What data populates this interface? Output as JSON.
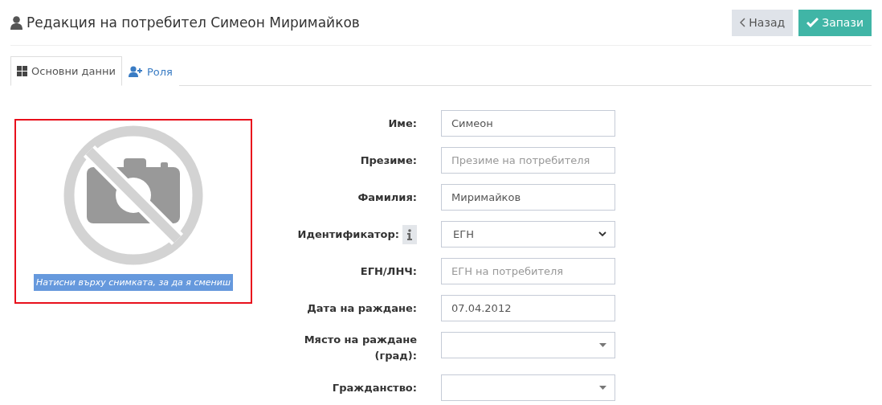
{
  "header": {
    "title": "Редакция на потребител Симеон Миримайков",
    "buttons": [
      {
        "kind": "back",
        "label": "Назад"
      },
      {
        "kind": "save",
        "label": "Запази"
      }
    ]
  },
  "tabs": [
    {
      "kind": "grid",
      "label": "Основни данни",
      "selected": true
    },
    {
      "kind": "user-plus",
      "label": "Роля",
      "selected": false
    }
  ],
  "photo": {
    "caption": "Натисни върху снимката, за да я смениш"
  },
  "fields": [
    {
      "kind": "text",
      "label": "Име:",
      "value": "Симеон"
    },
    {
      "kind": "text",
      "label": "Презиме:",
      "placeholder": "Презиме на потребителя"
    },
    {
      "kind": "text",
      "label": "Фамилия:",
      "value": "Миримайков"
    },
    {
      "kind": "select",
      "label": "Идентификатор:",
      "info": true,
      "value": "ЕГН"
    },
    {
      "kind": "text",
      "label": "ЕГН/ЛНЧ:",
      "placeholder": "ЕГН на потребителя"
    },
    {
      "kind": "text",
      "label": "Дата на раждане:",
      "value": "07.04.2012"
    },
    {
      "kind": "combo",
      "label": "Място на раждане (град):"
    },
    {
      "kind": "combo",
      "label": "Гражданство:"
    }
  ]
}
